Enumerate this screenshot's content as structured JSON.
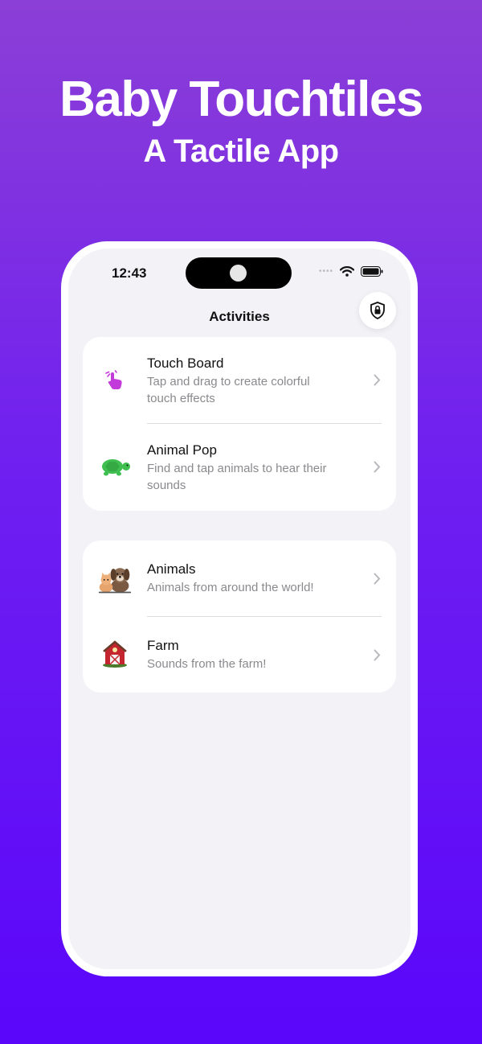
{
  "promo": {
    "title": "Baby Touchtiles",
    "subtitle": "A Tactile App"
  },
  "status_bar": {
    "time": "12:43"
  },
  "nav": {
    "title": "Activities"
  },
  "sections": [
    {
      "items": [
        {
          "title": "Touch Board",
          "subtitle": "Tap and drag to create colorful touch effects",
          "icon": "hand-tap-icon"
        },
        {
          "title": "Animal Pop",
          "subtitle": "Find and tap animals to hear their sounds",
          "icon": "turtle-icon"
        }
      ]
    },
    {
      "items": [
        {
          "title": "Animals",
          "subtitle": "Animals from around the world!",
          "icon": "dog-cat-icon"
        },
        {
          "title": "Farm",
          "subtitle": "Sounds from the farm!",
          "icon": "barn-icon"
        }
      ]
    }
  ],
  "colors": {
    "background_top": "#8c3fd6",
    "background_bottom": "#5a06fb",
    "touch_icon": "#c23ad9",
    "turtle": "#3fbf4f"
  }
}
